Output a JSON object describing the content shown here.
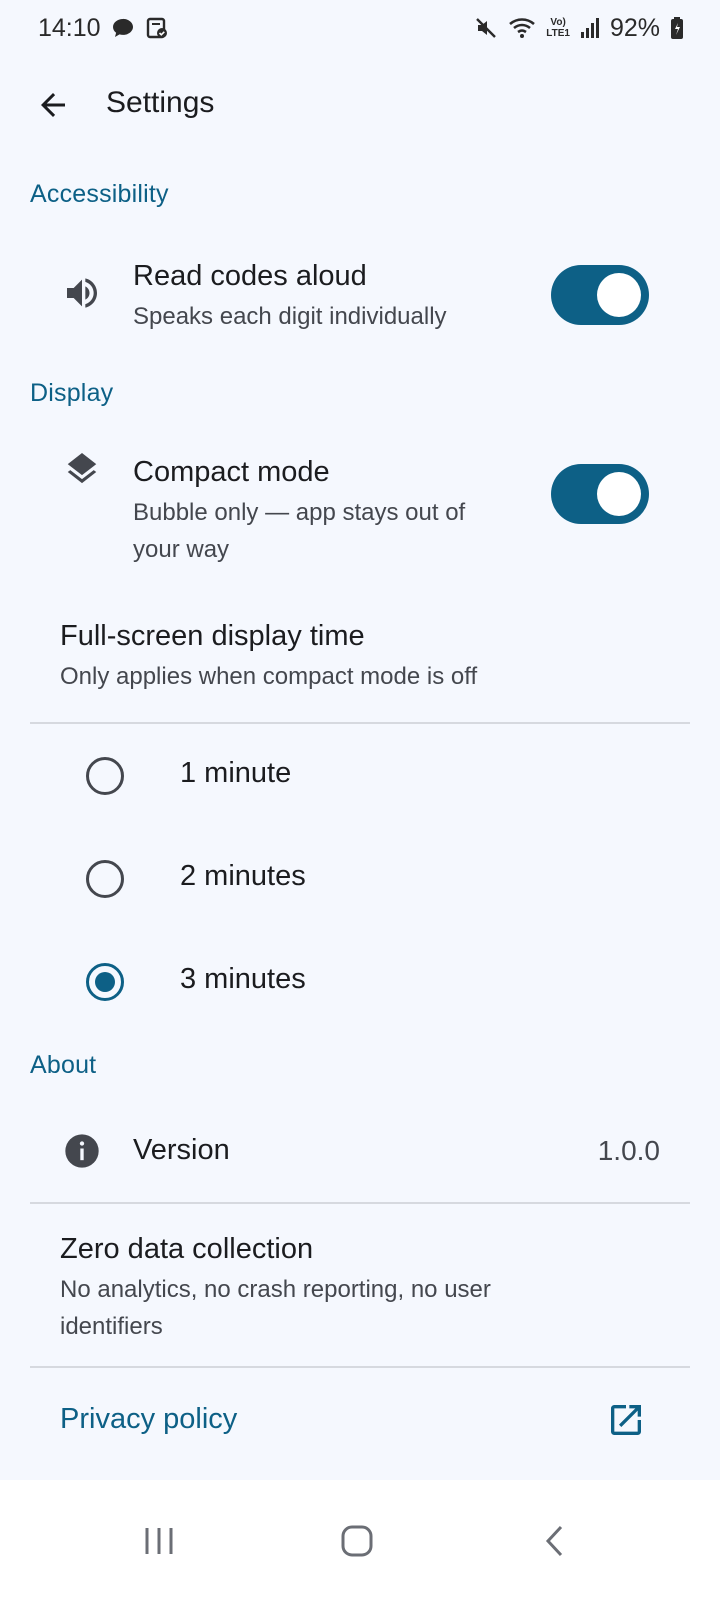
{
  "status_bar": {
    "time": "14:10",
    "battery": "92%",
    "network_label_top": "Vo)",
    "network_label_bottom": "LTE1",
    "icons_left": [
      "chat-bubble-icon",
      "clipboard-check-icon"
    ],
    "icons_right": [
      "mute-icon",
      "wifi-icon",
      "signal-icon",
      "battery-icon"
    ]
  },
  "app_bar": {
    "title": "Settings",
    "back_icon": "arrow-back-icon"
  },
  "sections": {
    "accessibility": {
      "header": "Accessibility",
      "read_aloud": {
        "title": "Read codes aloud",
        "subtitle": "Speaks each digit individually",
        "icon": "speaker-icon",
        "enabled": true
      }
    },
    "display": {
      "header": "Display",
      "compact": {
        "title": "Compact mode",
        "subtitle_line1": "Bubble only — app stays out of",
        "subtitle_line2": "your way",
        "icon": "layers-icon",
        "enabled": true
      },
      "fullscreen": {
        "title": "Full-screen display time",
        "subtitle": "Only applies when compact mode is off",
        "options": [
          "1 minute",
          "2 minutes",
          "3 minutes"
        ],
        "selected": "3 minutes"
      }
    },
    "about": {
      "header": "About",
      "version": {
        "title": "Version",
        "value": "1.0.0",
        "icon": "info-icon"
      },
      "privacy_note": {
        "title": "Zero data collection",
        "subtitle_line1": "No analytics, no crash reporting, no user",
        "subtitle_line2": "identifiers"
      },
      "privacy_policy": {
        "label": "Privacy policy",
        "icon": "open-external-icon"
      }
    }
  },
  "nav_bar": {
    "icons": [
      "recents-icon",
      "home-icon",
      "back-icon"
    ]
  },
  "colors": {
    "accent": "#0d6086",
    "background": "#f5f8fe",
    "text_primary": "#1b1c1f",
    "text_secondary": "#44474e"
  }
}
